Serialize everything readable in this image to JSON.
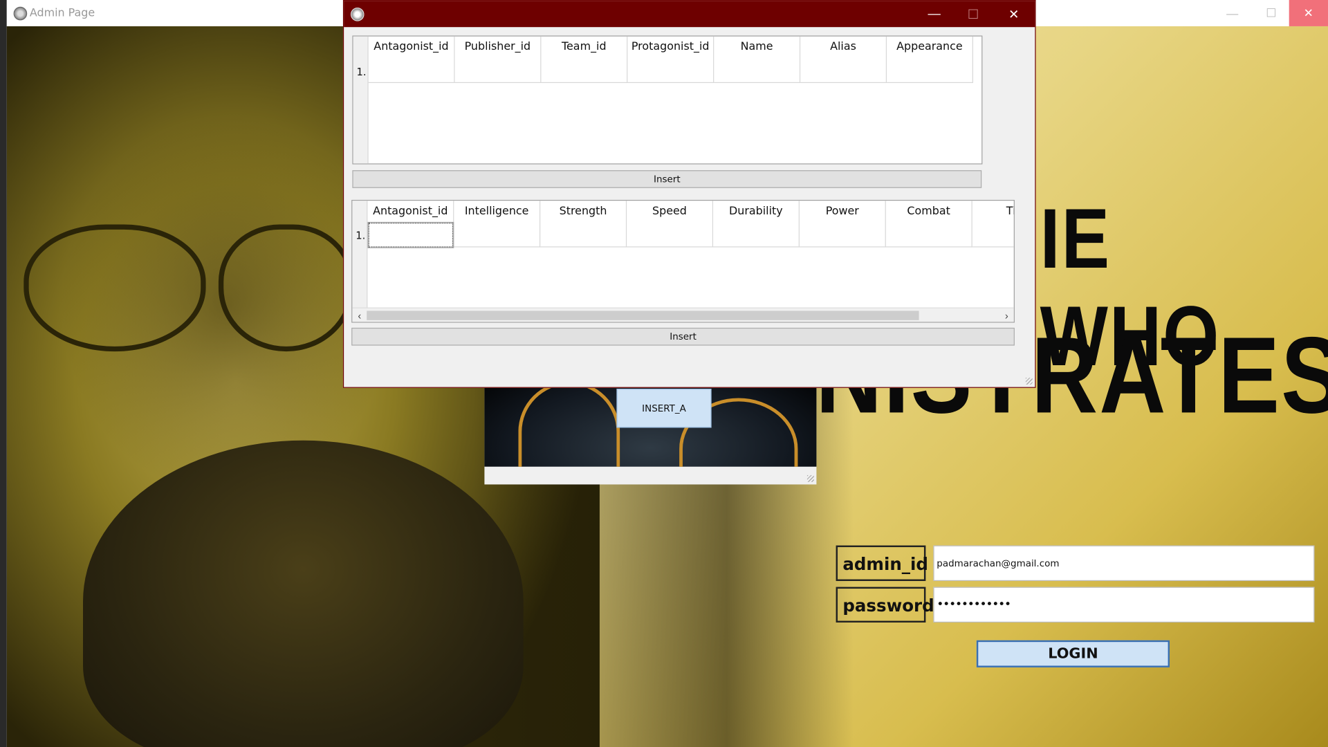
{
  "main_window": {
    "title": "Admin Page",
    "headline_top": "IE WHO",
    "headline_bottom": "NISTRATES",
    "login": {
      "id_label": "admin_id",
      "password_label": "password",
      "id_value": "padmarachan@gmail.com",
      "password_value": "••••••••••••",
      "login_button": "LOGIN"
    },
    "controls": {
      "minimize": "—",
      "maximize": "☐",
      "close": "✕"
    }
  },
  "middle_window": {
    "insert_button": "INSERT_A"
  },
  "dialog": {
    "controls": {
      "minimize": "—",
      "maximize": "☐",
      "close": "✕"
    },
    "grid1": {
      "columns": [
        "Antagonist_id",
        "Publisher_id",
        "Team_id",
        "Protagonist_id",
        "Name",
        "Alias",
        "Appearance"
      ],
      "row_label": "1.",
      "insert_button": "Insert"
    },
    "grid2": {
      "columns": [
        "Antagonist_id",
        "Intelligence",
        "Strength",
        "Speed",
        "Durability",
        "Power",
        "Combat",
        "Ti"
      ],
      "row_label": "1.",
      "insert_button": "Insert",
      "scroll_left": "‹",
      "scroll_right": "›"
    }
  },
  "colors": {
    "dialog_titlebar": "#6e0000",
    "button_blue": "#cfe3f6",
    "background_gold": "#d8bd4e"
  }
}
